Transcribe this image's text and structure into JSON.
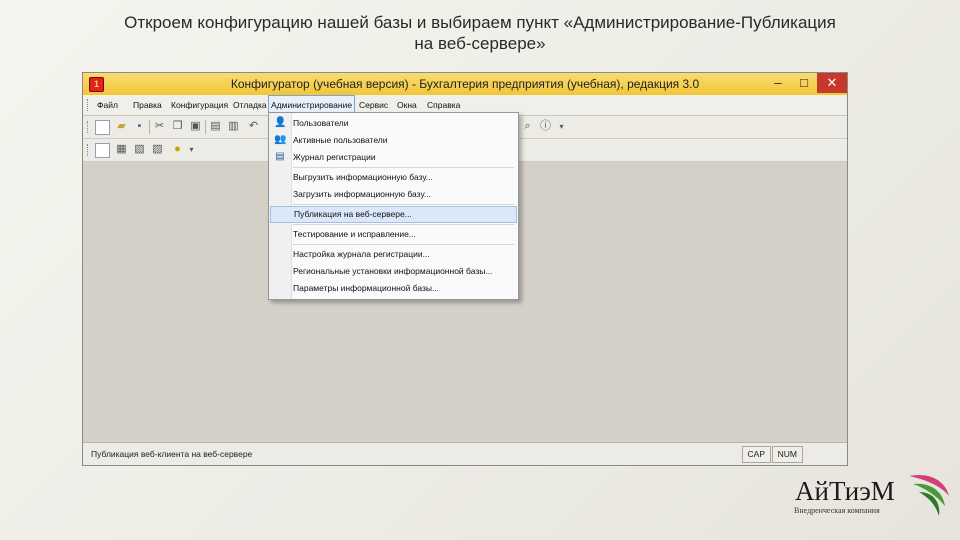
{
  "slide": {
    "title_line1": "Откроем конфигурацию нашей базы и выбираем пункт «Администрирование-Публикация",
    "title_line2": "на веб-сервере»"
  },
  "window": {
    "title": "Конфигуратор (учебная версия) - Бухгалтерия предприятия (учебная), редакция 3.0",
    "minimize": "–",
    "maximize": "□",
    "close": "✕"
  },
  "menu": {
    "items": [
      "Файл",
      "Правка",
      "Конфигурация",
      "Отладка",
      "Администрирование",
      "Сервис",
      "Окна",
      "Справка"
    ]
  },
  "dropdown": {
    "items": [
      {
        "label": "Пользователи",
        "icon": "users-icon",
        "glyph": "👤"
      },
      {
        "label": "Активные пользователи",
        "icon": "active-users-icon",
        "glyph": "👥"
      },
      {
        "label": "Журнал регистрации",
        "icon": "log-icon",
        "glyph": "▤"
      },
      {
        "label": "Выгрузить информационную базу...",
        "icon": "",
        "glyph": ""
      },
      {
        "label": "Загрузить информационную базу...",
        "icon": "",
        "glyph": ""
      },
      {
        "label": "Публикация на веб-сервере...",
        "icon": "",
        "glyph": ""
      },
      {
        "label": "Тестирование и исправление...",
        "icon": "",
        "glyph": ""
      },
      {
        "label": "Настройка журнала регистрации...",
        "icon": "",
        "glyph": ""
      },
      {
        "label": "Региональные установки информационной базы...",
        "icon": "",
        "glyph": ""
      },
      {
        "label": "Параметры информационной базы...",
        "icon": "",
        "glyph": ""
      }
    ],
    "highlighted_index": 5
  },
  "status": {
    "text": "Публикация веб-клиента на веб-сервере",
    "cap": "CAP",
    "num": "NUM"
  },
  "logo": {
    "name": "АйТиэМ",
    "tagline": "Внедренческая компания"
  },
  "colors": {
    "titlebar": "#f2c637",
    "highlight": "#dbe8f9",
    "close_button": "#c7382c",
    "logo_green": "#4a9a3a",
    "logo_pink": "#d2407a"
  }
}
